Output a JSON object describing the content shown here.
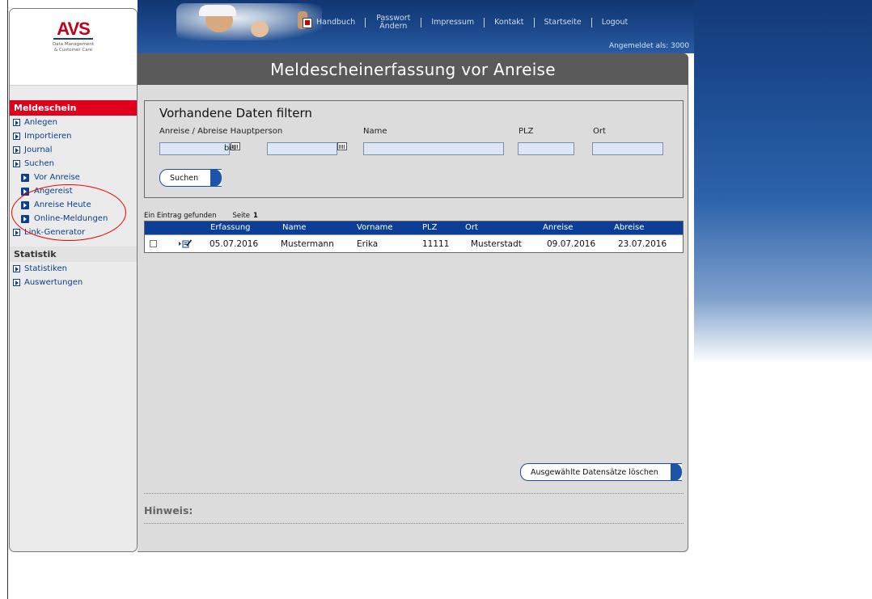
{
  "header": {
    "nav": [
      {
        "label": "Handbuch"
      },
      {
        "label": "Passwort Ändern"
      },
      {
        "label": "Impressum"
      },
      {
        "label": "Kontakt"
      },
      {
        "label": "Startseite"
      },
      {
        "label": "Logout"
      }
    ],
    "logged_in_as": "Angemeldet als: 3000"
  },
  "logo": {
    "text": "AVS",
    "line1": "Data Management",
    "line2": "& Customer Care"
  },
  "page_title": "Meldescheinerfassung vor Anreise",
  "sidebar": {
    "section1": "Meldeschein",
    "items": [
      {
        "label": "Anlegen"
      },
      {
        "label": "Importieren"
      },
      {
        "label": "Journal"
      },
      {
        "label": "Suchen"
      }
    ],
    "subitems": [
      {
        "label": "Vor Anreise"
      },
      {
        "label": "Angereist"
      },
      {
        "label": "Anreise Heute"
      },
      {
        "label": "Online-Meldungen"
      }
    ],
    "link_generator": "Link-Generator",
    "section2": "Statistik",
    "items2": [
      {
        "label": "Statistiken"
      },
      {
        "label": "Auswertungen"
      }
    ]
  },
  "filter": {
    "title": "Vorhandene Daten filtern",
    "label_dates": "Anreise / Abreise Hauptperson",
    "label_bis": "bis",
    "label_name": "Name",
    "label_plz": "PLZ",
    "label_ort": "Ort",
    "search_button": "Suchen"
  },
  "results": {
    "info": "Ein Eintrag gefunden",
    "page_label": "Seite",
    "page_number": "1",
    "columns": [
      "Erfassung",
      "Name",
      "Vorname",
      "PLZ",
      "Ort",
      "Anreise",
      "Abreise"
    ],
    "rows": [
      {
        "erfassung": "05.07.2016",
        "name": "Mustermann",
        "vorname": "Erika",
        "plz": "11111",
        "ort": "Musterstadt",
        "anreise": "09.07.2016",
        "abreise": "23.07.2016"
      }
    ]
  },
  "delete_button": "Ausgewählte Datensätze löschen",
  "hinweis": "Hinweis:",
  "colors": {
    "accent_red": "#e0001b",
    "nav_blue": "#0b3e94",
    "title_gray": "#5a5a5a"
  }
}
